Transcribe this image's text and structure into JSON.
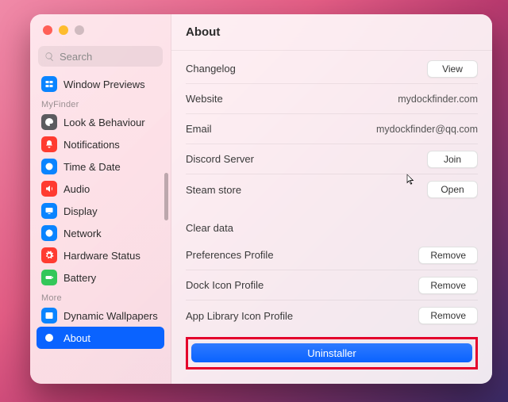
{
  "window_title": "About",
  "search": {
    "placeholder": "Search"
  },
  "sidebar": {
    "top": [
      {
        "label": "Window Previews",
        "icon": "windows",
        "color": "#0a84ff"
      }
    ],
    "groups": [
      {
        "title": "MyFinder",
        "items": [
          {
            "label": "Look & Behaviour",
            "icon": "paint",
            "color": "#5b5b5f"
          },
          {
            "label": "Notifications",
            "icon": "bell",
            "color": "#ff3b30"
          },
          {
            "label": "Time & Date",
            "icon": "clock",
            "color": "#0a84ff"
          },
          {
            "label": "Audio",
            "icon": "sound",
            "color": "#ff3b30"
          },
          {
            "label": "Display",
            "icon": "display",
            "color": "#0a84ff"
          },
          {
            "label": "Network",
            "icon": "globe",
            "color": "#0a84ff"
          },
          {
            "label": "Hardware Status",
            "icon": "gear",
            "color": "#ff3b30"
          },
          {
            "label": "Battery",
            "icon": "battery",
            "color": "#34c759"
          }
        ]
      },
      {
        "title": "More",
        "items": [
          {
            "label": "Dynamic Wallpapers",
            "icon": "image",
            "color": "#0a84ff"
          },
          {
            "label": "About",
            "icon": "info",
            "color": "#0a63ff",
            "selected": true
          }
        ]
      }
    ]
  },
  "about": {
    "links": [
      {
        "label": "Changelog",
        "action_label": "View"
      },
      {
        "label": "Website",
        "value": "mydockfinder.com"
      },
      {
        "label": "Email",
        "value": "mydockfinder@qq.com"
      },
      {
        "label": "Discord Server",
        "action_label": "Join"
      },
      {
        "label": "Steam store",
        "action_label": "Open"
      }
    ],
    "clear_data_title": "Clear data",
    "clear_data": [
      {
        "label": "Preferences Profile",
        "action_label": "Remove"
      },
      {
        "label": "Dock Icon Profile",
        "action_label": "Remove"
      },
      {
        "label": "App Library Icon Profile",
        "action_label": "Remove"
      }
    ],
    "uninstaller_label": "Uninstaller"
  }
}
